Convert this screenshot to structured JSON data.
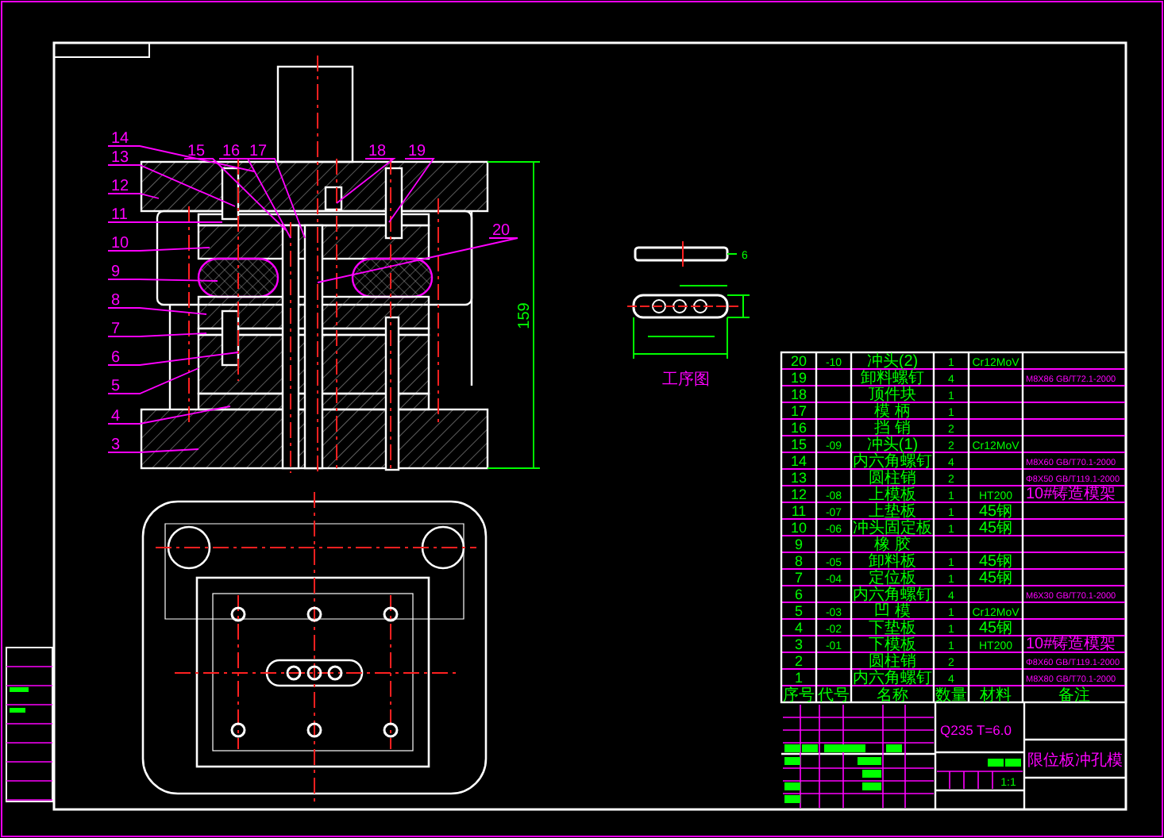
{
  "assembly_drawing": {
    "callouts": [
      {
        "number": "14"
      },
      {
        "number": "13"
      },
      {
        "number": "12"
      },
      {
        "number": "11"
      },
      {
        "number": "10"
      },
      {
        "number": "9"
      },
      {
        "number": "8"
      },
      {
        "number": "7"
      },
      {
        "number": "6"
      },
      {
        "number": "5"
      },
      {
        "number": "4"
      },
      {
        "number": "3"
      },
      {
        "number": "15"
      },
      {
        "number": "16"
      },
      {
        "number": "17"
      },
      {
        "number": "18"
      },
      {
        "number": "19"
      },
      {
        "number": "20"
      }
    ],
    "height_dimension": "159"
  },
  "workpiece": {
    "dimension": "6",
    "caption": "工序图"
  },
  "parts_list": {
    "columns": [
      "序号",
      "代号",
      "名称",
      "数量",
      "材料",
      "备注"
    ],
    "rows": [
      {
        "no": "20",
        "code": "-10",
        "name": "冲头(2)",
        "qty": "1",
        "material": "Cr12MoV",
        "note": ""
      },
      {
        "no": "19",
        "code": "",
        "name": "卸料螺钉",
        "qty": "4",
        "material": "",
        "note": "M8X86 GB/T72.1-2000"
      },
      {
        "no": "18",
        "code": "",
        "name": "顶件块",
        "qty": "1",
        "material": "",
        "note": ""
      },
      {
        "no": "17",
        "code": "",
        "name": "模 柄",
        "qty": "1",
        "material": "",
        "note": ""
      },
      {
        "no": "16",
        "code": "",
        "name": "挡 销",
        "qty": "2",
        "material": "",
        "note": ""
      },
      {
        "no": "15",
        "code": "-09",
        "name": "冲头(1)",
        "qty": "2",
        "material": "Cr12MoV",
        "note": ""
      },
      {
        "no": "14",
        "code": "",
        "name": "内六角螺钉",
        "qty": "4",
        "material": "",
        "note": "M8X60 GB/T70.1-2000"
      },
      {
        "no": "13",
        "code": "",
        "name": "圆柱销",
        "qty": "2",
        "material": "",
        "note": "Φ8X50 GB/T119.1-2000"
      },
      {
        "no": "12",
        "code": "-08",
        "name": "上模板",
        "qty": "1",
        "material": "HT200",
        "note": "10#铸造模架"
      },
      {
        "no": "11",
        "code": "-07",
        "name": "上垫板",
        "qty": "1",
        "material": "45钢",
        "note": ""
      },
      {
        "no": "10",
        "code": "-06",
        "name": "冲头固定板",
        "qty": "1",
        "material": "45钢",
        "note": ""
      },
      {
        "no": "9",
        "code": "",
        "name": "橡 胶",
        "qty": "",
        "material": "",
        "note": ""
      },
      {
        "no": "8",
        "code": "-05",
        "name": "卸料板",
        "qty": "1",
        "material": "45钢",
        "note": ""
      },
      {
        "no": "7",
        "code": "-04",
        "name": "定位板",
        "qty": "1",
        "material": "45钢",
        "note": ""
      },
      {
        "no": "6",
        "code": "",
        "name": "内六角螺钉",
        "qty": "4",
        "material": "",
        "note": "M6X30 GB/T70.1-2000"
      },
      {
        "no": "5",
        "code": "-03",
        "name": "凹 模",
        "qty": "1",
        "material": "Cr12MoV",
        "note": ""
      },
      {
        "no": "4",
        "code": "-02",
        "name": "下垫板",
        "qty": "1",
        "material": "45钢",
        "note": ""
      },
      {
        "no": "3",
        "code": "-01",
        "name": "下模板",
        "qty": "1",
        "material": "HT200",
        "note": "10#铸造模架"
      },
      {
        "no": "2",
        "code": "",
        "name": "圆柱销",
        "qty": "2",
        "material": "",
        "note": "Φ8X60 GB/T119.1-2000"
      },
      {
        "no": "1",
        "code": "",
        "name": "内六角螺钉",
        "qty": "4",
        "material": "",
        "note": "M8X80 GB/T70.1-2000"
      }
    ]
  },
  "title_block": {
    "material": "Q235  T=6.0",
    "drawing_name": "限位板冲孔模",
    "scale": "1:1"
  }
}
